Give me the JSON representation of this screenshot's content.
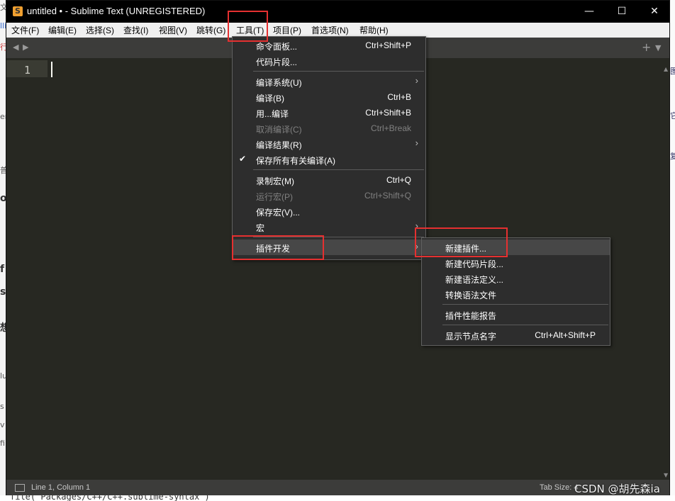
{
  "app": {
    "title": "untitled • - Sublime Text (UNREGISTERED)",
    "icon_glyph": "S",
    "window_buttons": {
      "minimize": "—",
      "maximize": "☐",
      "close": "✕"
    }
  },
  "menubar": {
    "items": [
      "文件(F)",
      "编辑(E)",
      "选择(S)",
      "查找(I)",
      "视图(V)",
      "跳转(G)",
      "工具(T)",
      "项目(P)",
      "首选项(N)",
      "帮助(H)"
    ]
  },
  "editor": {
    "line_number": "1"
  },
  "tools_menu": {
    "items": [
      {
        "label": "命令面板...",
        "shortcut": "Ctrl+Shift+P"
      },
      {
        "label": "代码片段...",
        "shortcut": ""
      },
      {
        "label": "编译系统(U)",
        "shortcut": "",
        "submenu": true
      },
      {
        "label": "编译(B)",
        "shortcut": "Ctrl+B"
      },
      {
        "label": "用...编译",
        "shortcut": "Ctrl+Shift+B"
      },
      {
        "label": "取消编译(C)",
        "shortcut": "Ctrl+Break",
        "disabled": true
      },
      {
        "label": "编译结果(R)",
        "shortcut": "",
        "submenu": true
      },
      {
        "label": "保存所有有关编译(A)",
        "shortcut": "",
        "checked": true
      },
      {
        "label": "录制宏(M)",
        "shortcut": "Ctrl+Q"
      },
      {
        "label": "运行宏(P)",
        "shortcut": "Ctrl+Shift+Q",
        "disabled": true
      },
      {
        "label": "保存宏(V)...",
        "shortcut": ""
      },
      {
        "label": "宏",
        "shortcut": "",
        "submenu": true
      },
      {
        "label": "插件开发",
        "shortcut": "",
        "submenu": true,
        "highlighted": true
      }
    ]
  },
  "plugin_submenu": {
    "items": [
      {
        "label": "新建插件...",
        "shortcut": "",
        "highlighted": true
      },
      {
        "label": "新建代码片段...",
        "shortcut": ""
      },
      {
        "label": "新建语法定义...",
        "shortcut": ""
      },
      {
        "label": "转换语法文件",
        "shortcut": ""
      },
      {
        "label": "插件性能报告",
        "shortcut": ""
      },
      {
        "label": "显示节点名字",
        "shortcut": "Ctrl+Alt+Shift+P"
      }
    ]
  },
  "statusbar": {
    "position": "Line 1, Column 1",
    "tab_size": "Tab Size: 4"
  },
  "watermark": "CSDN @胡先森ia",
  "background_page": {
    "left_fragments": [
      "文",
      "lli",
      "行",
      "er",
      "普",
      "o",
      "f",
      "s",
      "想",
      "lu",
      "s",
      "v",
      "fi"
    ],
    "right_fragments": [
      "图",
      "它",
      "复"
    ],
    "bottom_text": "file( Packages/C++/C++.sublime-syntax )"
  },
  "colors": {
    "editor_bg": "#272822",
    "menu_bg": "#2d2d2d",
    "highlight_box": "#e53030"
  }
}
